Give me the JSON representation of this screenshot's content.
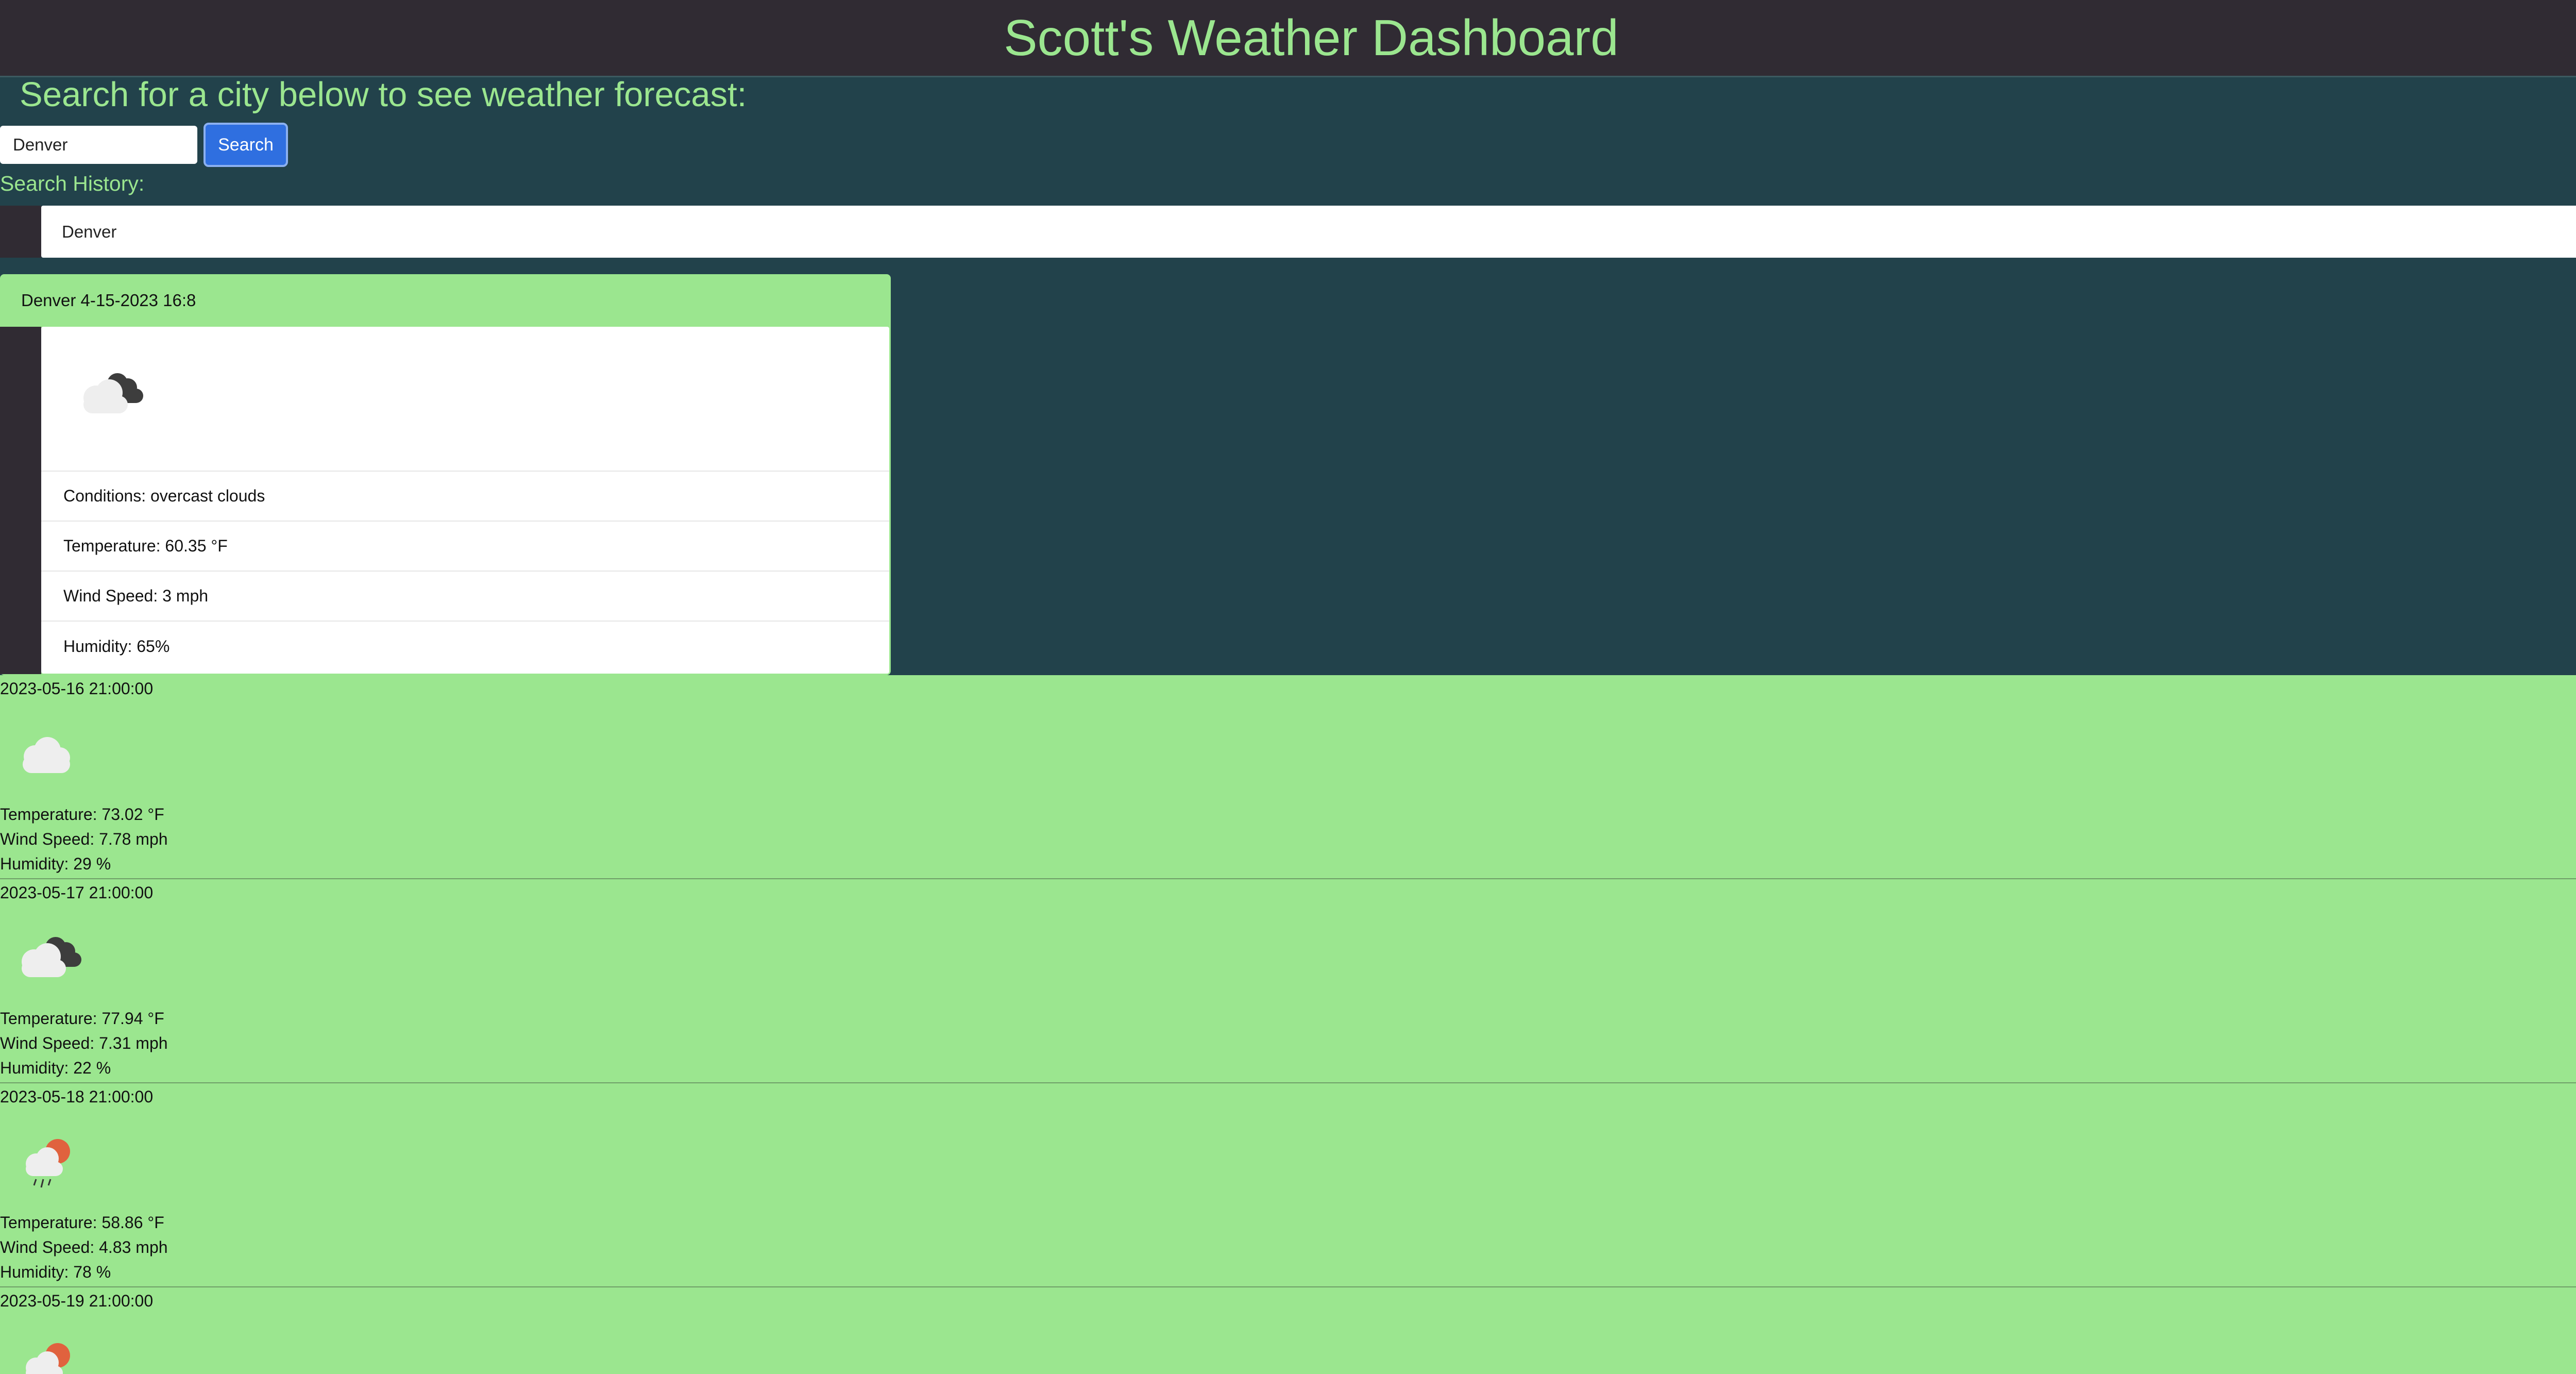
{
  "header": {
    "title": "Scott's Weather Dashboard"
  },
  "search": {
    "prompt": "Search for a city below to see weather forecast:",
    "input_value": "Denver",
    "button_label": "Search"
  },
  "history": {
    "label": "Search History:",
    "items": [
      {
        "label": "Denver"
      }
    ]
  },
  "current": {
    "header": "Denver 4-15-2023 16:8",
    "icon": "overcast-clouds-icon",
    "conditions": "Conditions: overcast clouds",
    "temperature": "Temperature: 60.35 °F",
    "wind": "Wind Speed: 3 mph",
    "humidity": "Humidity: 65%"
  },
  "forecast": [
    {
      "date": "2023-05-16 21:00:00",
      "icon": "cloud-icon",
      "temperature": "Temperature: 73.02 °F",
      "wind": "Wind Speed: 7.78 mph",
      "humidity": "Humidity: 29 %"
    },
    {
      "date": "2023-05-17 21:00:00",
      "icon": "broken-clouds-icon",
      "temperature": "Temperature: 77.94 °F",
      "wind": "Wind Speed: 7.31 mph",
      "humidity": "Humidity: 22 %"
    },
    {
      "date": "2023-05-18 21:00:00",
      "icon": "rain-sun-icon",
      "temperature": "Temperature: 58.86 °F",
      "wind": "Wind Speed: 4.83 mph",
      "humidity": "Humidity: 78 %"
    },
    {
      "date": "2023-05-19 21:00:00",
      "icon": "rain-sun-icon"
    }
  ],
  "colors": {
    "header_bg": "#302b33",
    "page_bg": "#22424b",
    "accent_text": "#9be68f",
    "card_bg": "#9be68f",
    "button_bg": "#2f6fe0"
  }
}
